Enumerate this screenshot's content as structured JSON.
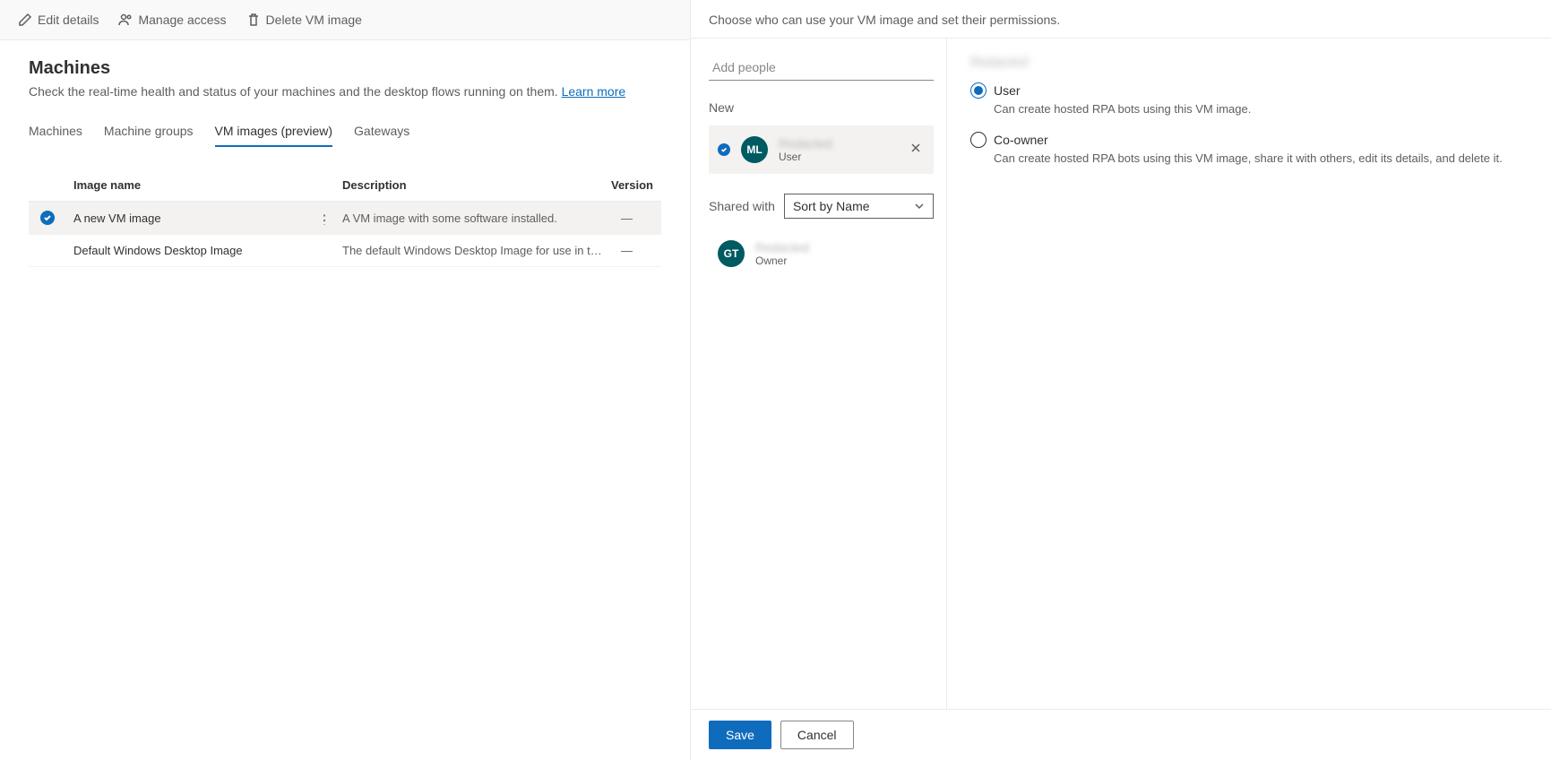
{
  "toolbar": {
    "edit": "Edit details",
    "manage": "Manage access",
    "delete": "Delete VM image"
  },
  "page": {
    "title": "Machines",
    "subtitle_prefix": "Check the real-time health and status of your machines and the desktop flows running on them. ",
    "learn_more": "Learn more"
  },
  "tabs": [
    {
      "label": "Machines",
      "active": false
    },
    {
      "label": "Machine groups",
      "active": false
    },
    {
      "label": "VM images (preview)",
      "active": true
    },
    {
      "label": "Gateways",
      "active": false
    }
  ],
  "columns": {
    "name": "Image name",
    "description": "Description",
    "version": "Version"
  },
  "rows": [
    {
      "selected": true,
      "name": "A new VM image",
      "description": "A VM image with some software installed.",
      "version": "—"
    },
    {
      "selected": false,
      "name": "Default Windows Desktop Image",
      "description": "The default Windows Desktop Image for use in the Product ...",
      "version": "—"
    }
  ],
  "panel": {
    "description": "Choose who can use your VM image and set their permissions.",
    "add_placeholder": "Add people",
    "new_label": "New",
    "new_person": {
      "initials": "ML",
      "name": "Redacted",
      "role": "User"
    },
    "shared_with_label": "Shared with",
    "sort_label": "Sort by Name",
    "shared_person": {
      "initials": "GT",
      "name": "Redacted",
      "role": "Owner"
    },
    "permissions_heading": "Redacted",
    "permissions": [
      {
        "label": "User",
        "selected": true,
        "description": "Can create hosted RPA bots using this VM image."
      },
      {
        "label": "Co-owner",
        "selected": false,
        "description": "Can create hosted RPA bots using this VM image, share it with others, edit its details, and delete it."
      }
    ],
    "save": "Save",
    "cancel": "Cancel"
  }
}
